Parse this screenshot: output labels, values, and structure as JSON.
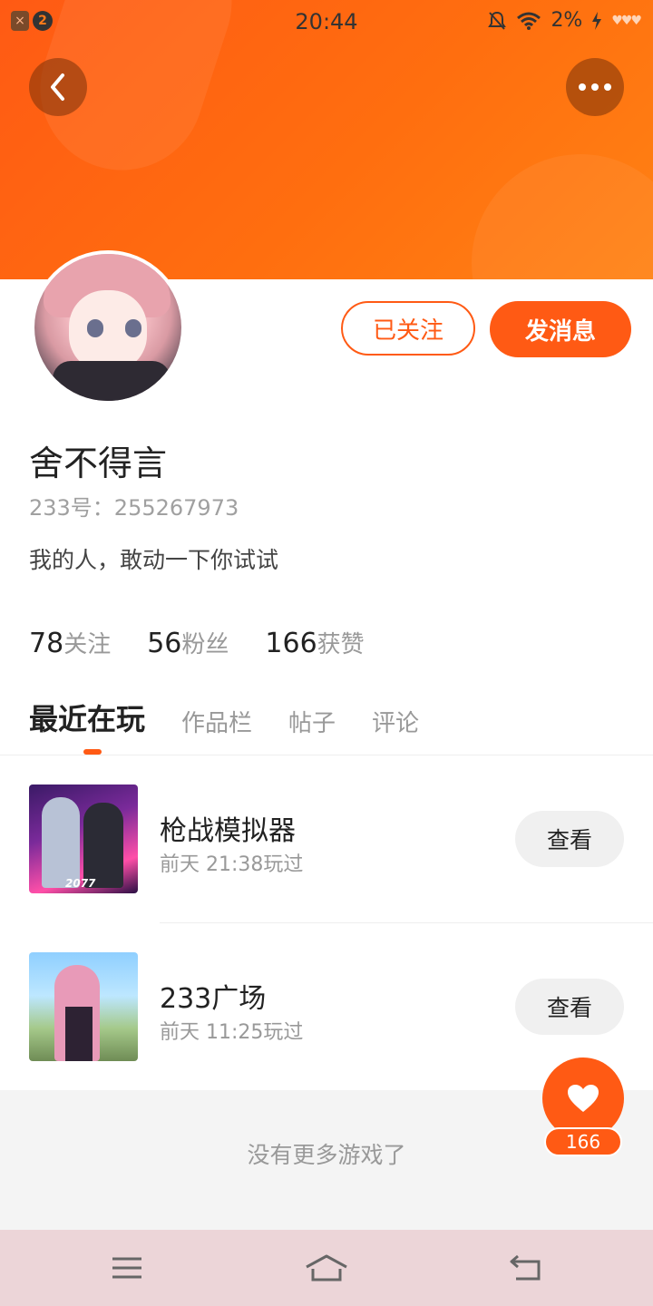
{
  "status_bar": {
    "time": "20:44",
    "battery": "2%",
    "notif_count": "2"
  },
  "profile": {
    "name": "舍不得言",
    "uid": "233号：255267973",
    "bio": "我的人，敢动一下你试试",
    "follow_state_label": "已关注",
    "message_label": "发消息"
  },
  "stats": [
    {
      "num": "78",
      "label": "关注"
    },
    {
      "num": "56",
      "label": "粉丝"
    },
    {
      "num": "166",
      "label": "获赞"
    }
  ],
  "tabs": [
    "最近在玩",
    "作品栏",
    "帖子",
    "评论"
  ],
  "games": [
    {
      "name": "枪战模拟器",
      "time": "前天 21:38玩过",
      "action": "查看",
      "thumb_tag": "2077"
    },
    {
      "name": "233广场",
      "time": "前天 11:25玩过",
      "action": "查看"
    }
  ],
  "footer": {
    "no_more": "没有更多游戏了"
  },
  "like_fab": {
    "count": "166"
  },
  "colors": {
    "accent": "#ff5a14",
    "banner_start": "#ff5a14",
    "banner_end": "#ff8214"
  },
  "icons": {
    "back": "chevron-left-icon",
    "more": "more-dots-icon",
    "like": "heart-icon",
    "nav_menu": "menu-icon",
    "nav_home": "home-icon",
    "nav_back": "return-icon"
  }
}
